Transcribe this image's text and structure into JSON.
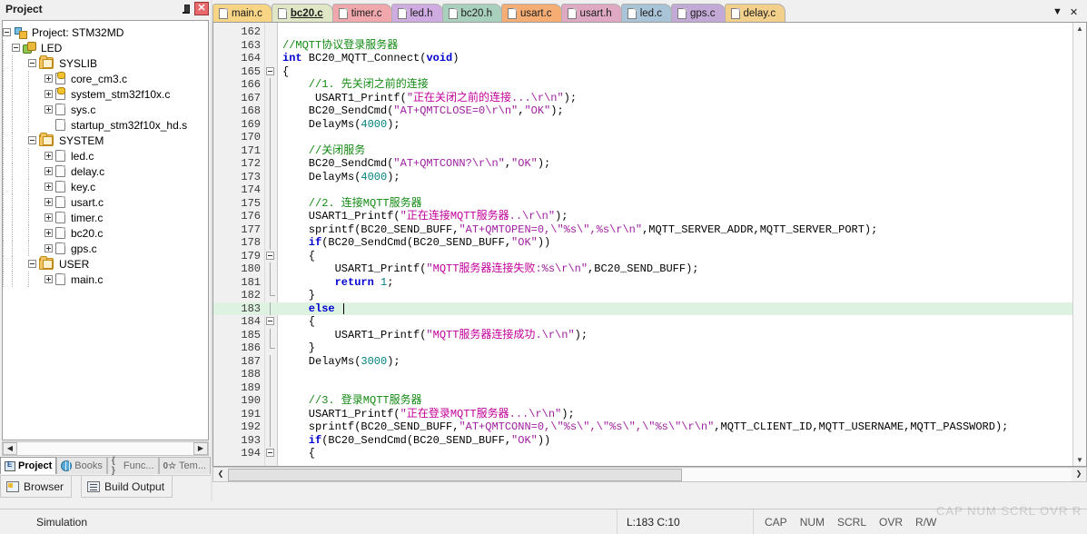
{
  "project_panel": {
    "title": "Project",
    "pin_icon": "pin-icon",
    "close_icon": "close-icon",
    "tree": [
      {
        "label": "Project: STM32MD",
        "depth": 0,
        "expander": "minus",
        "icon": "project-icon"
      },
      {
        "label": "LED",
        "depth": 1,
        "expander": "minus",
        "icon": "target-icon"
      },
      {
        "label": "SYSLIB",
        "depth": 2,
        "expander": "minus",
        "icon": "folder-group-icon"
      },
      {
        "label": "core_cm3.c",
        "depth": 3,
        "expander": "plus",
        "icon": "source-file-keyed-icon"
      },
      {
        "label": "system_stm32f10x.c",
        "depth": 3,
        "expander": "plus",
        "icon": "source-file-keyed-icon"
      },
      {
        "label": "sys.c",
        "depth": 3,
        "expander": "plus",
        "icon": "source-file-icon"
      },
      {
        "label": "startup_stm32f10x_hd.s",
        "depth": 3,
        "expander": "none",
        "icon": "source-file-icon"
      },
      {
        "label": "SYSTEM",
        "depth": 2,
        "expander": "minus",
        "icon": "folder-group-icon"
      },
      {
        "label": "led.c",
        "depth": 3,
        "expander": "plus",
        "icon": "source-file-icon"
      },
      {
        "label": "delay.c",
        "depth": 3,
        "expander": "plus",
        "icon": "source-file-icon"
      },
      {
        "label": "key.c",
        "depth": 3,
        "expander": "plus",
        "icon": "source-file-icon"
      },
      {
        "label": "usart.c",
        "depth": 3,
        "expander": "plus",
        "icon": "source-file-icon"
      },
      {
        "label": "timer.c",
        "depth": 3,
        "expander": "plus",
        "icon": "source-file-icon"
      },
      {
        "label": "bc20.c",
        "depth": 3,
        "expander": "plus",
        "icon": "source-file-icon"
      },
      {
        "label": "gps.c",
        "depth": 3,
        "expander": "plus",
        "icon": "source-file-icon"
      },
      {
        "label": "USER",
        "depth": 2,
        "expander": "minus",
        "icon": "folder-group-icon"
      },
      {
        "label": "main.c",
        "depth": 3,
        "expander": "plus",
        "icon": "source-file-icon"
      }
    ],
    "panel_tabs": [
      {
        "label": "Project",
        "active": true,
        "icon": "project-tab-icon"
      },
      {
        "label": "Books",
        "active": false,
        "icon": "books-globe-icon"
      },
      {
        "label": "Func...",
        "active": false,
        "icon": "braces-icon"
      },
      {
        "label": "Tem...",
        "active": false,
        "icon": "templates-icon"
      }
    ],
    "dock_tabs": [
      {
        "label": "Browser",
        "icon": "browser-icon"
      },
      {
        "label": "Build Output",
        "icon": "build-output-icon"
      }
    ]
  },
  "editor": {
    "tabs": [
      {
        "label": "main.c",
        "active": false,
        "color": "#f8d485"
      },
      {
        "label": "bc20.c",
        "active": true,
        "color": "#dfe7c6"
      },
      {
        "label": "timer.c",
        "active": false,
        "color": "#f0a8ac"
      },
      {
        "label": "led.h",
        "active": false,
        "color": "#ceabe0"
      },
      {
        "label": "bc20.h",
        "active": false,
        "color": "#a9cfbd"
      },
      {
        "label": "usart.c",
        "active": false,
        "color": "#f5ad74"
      },
      {
        "label": "usart.h",
        "active": false,
        "color": "#dfa9c4"
      },
      {
        "label": "led.c",
        "active": false,
        "color": "#a8c4d6"
      },
      {
        "label": "gps.c",
        "active": false,
        "color": "#c3a9d6"
      },
      {
        "label": "delay.c",
        "active": false,
        "color": "#f2cf8a"
      }
    ],
    "tab_dropdown_icon": "chevron-down-icon",
    "tab_close_icon": "close-icon",
    "current_line": 183,
    "lines": [
      {
        "n": 162,
        "fold": "",
        "tokens": []
      },
      {
        "n": 163,
        "fold": "",
        "tokens": [
          {
            "t": "//MQTT协议登录服务器",
            "c": "c",
            "ind": 0
          }
        ]
      },
      {
        "n": 164,
        "fold": "",
        "tokens": [
          {
            "t": "int",
            "c": "k",
            "ind": 0
          },
          {
            "t": " BC20_MQTT_Connect(",
            "c": "p"
          },
          {
            "t": "void",
            "c": "k"
          },
          {
            "t": ")",
            "c": "p"
          }
        ]
      },
      {
        "n": 165,
        "fold": "start",
        "tokens": [
          {
            "t": "{",
            "c": "p",
            "ind": 0
          }
        ]
      },
      {
        "n": 166,
        "fold": "bar",
        "tokens": [
          {
            "t": "//1. 先关闭之前的连接",
            "c": "c",
            "ind": 4
          }
        ]
      },
      {
        "n": 167,
        "fold": "bar",
        "tokens": [
          {
            "t": " USART1_Printf(",
            "c": "p",
            "ind": 4
          },
          {
            "t": "\"",
            "c": "s"
          },
          {
            "t": "正在关闭之前的连接",
            "c": "cz"
          },
          {
            "t": "...\\r\\n\"",
            "c": "s"
          },
          {
            "t": ");",
            "c": "p"
          }
        ]
      },
      {
        "n": 168,
        "fold": "bar",
        "tokens": [
          {
            "t": "BC20_SendCmd(",
            "c": "p",
            "ind": 4
          },
          {
            "t": "\"AT+QMTCLOSE=0\\r\\n\"",
            "c": "s"
          },
          {
            "t": ",",
            "c": "p"
          },
          {
            "t": "\"OK\"",
            "c": "s"
          },
          {
            "t": ");",
            "c": "p"
          }
        ]
      },
      {
        "n": 169,
        "fold": "bar",
        "tokens": [
          {
            "t": "DelayMs(",
            "c": "p",
            "ind": 4
          },
          {
            "t": "4000",
            "c": "n"
          },
          {
            "t": ");",
            "c": "p"
          }
        ]
      },
      {
        "n": 170,
        "fold": "bar",
        "tokens": []
      },
      {
        "n": 171,
        "fold": "bar",
        "tokens": [
          {
            "t": "//关闭服务",
            "c": "c",
            "ind": 4
          }
        ]
      },
      {
        "n": 172,
        "fold": "bar",
        "tokens": [
          {
            "t": "BC20_SendCmd(",
            "c": "p",
            "ind": 4
          },
          {
            "t": "\"AT+QMTCONN?\\r\\n\"",
            "c": "s"
          },
          {
            "t": ",",
            "c": "p"
          },
          {
            "t": "\"OK\"",
            "c": "s"
          },
          {
            "t": ");",
            "c": "p"
          }
        ]
      },
      {
        "n": 173,
        "fold": "bar",
        "tokens": [
          {
            "t": "DelayMs(",
            "c": "p",
            "ind": 4
          },
          {
            "t": "4000",
            "c": "n"
          },
          {
            "t": ");",
            "c": "p"
          }
        ]
      },
      {
        "n": 174,
        "fold": "bar",
        "tokens": []
      },
      {
        "n": 175,
        "fold": "bar",
        "tokens": [
          {
            "t": "//2. 连接MQTT服务器",
            "c": "c",
            "ind": 4
          }
        ]
      },
      {
        "n": 176,
        "fold": "bar",
        "tokens": [
          {
            "t": "USART1_Printf(",
            "c": "p",
            "ind": 4
          },
          {
            "t": "\"",
            "c": "s"
          },
          {
            "t": "正在连接MQTT服务器",
            "c": "cz"
          },
          {
            "t": "..\\r\\n\"",
            "c": "s"
          },
          {
            "t": ");",
            "c": "p"
          }
        ]
      },
      {
        "n": 177,
        "fold": "bar",
        "tokens": [
          {
            "t": "sprintf(BC20_SEND_BUFF,",
            "c": "p",
            "ind": 4
          },
          {
            "t": "\"AT+QMTOPEN=0,\\\"%s\\\",%s\\r\\n\"",
            "c": "s"
          },
          {
            "t": ",MQTT_SERVER_ADDR,MQTT_SERVER_PORT);",
            "c": "p"
          }
        ]
      },
      {
        "n": 178,
        "fold": "bar",
        "tokens": [
          {
            "t": "if",
            "c": "k",
            "ind": 4
          },
          {
            "t": "(BC20_SendCmd(BC20_SEND_BUFF,",
            "c": "p"
          },
          {
            "t": "\"OK\"",
            "c": "s"
          },
          {
            "t": "))",
            "c": "p"
          }
        ]
      },
      {
        "n": 179,
        "fold": "start2",
        "tokens": [
          {
            "t": "{",
            "c": "p",
            "ind": 4
          }
        ]
      },
      {
        "n": 180,
        "fold": "bar2",
        "tokens": [
          {
            "t": "USART1_Printf(",
            "c": "p",
            "ind": 8
          },
          {
            "t": "\"",
            "c": "s"
          },
          {
            "t": "MQTT服务器连接失败",
            "c": "cz"
          },
          {
            "t": ":%s\\r\\n\"",
            "c": "s"
          },
          {
            "t": ",BC20_SEND_BUFF);",
            "c": "p"
          }
        ]
      },
      {
        "n": 181,
        "fold": "bar2",
        "tokens": [
          {
            "t": "return",
            "c": "k",
            "ind": 8
          },
          {
            "t": " ",
            "c": "p"
          },
          {
            "t": "1",
            "c": "n"
          },
          {
            "t": ";",
            "c": "p"
          }
        ]
      },
      {
        "n": 182,
        "fold": "end2",
        "tokens": [
          {
            "t": "}",
            "c": "p",
            "ind": 4
          }
        ]
      },
      {
        "n": 183,
        "fold": "bar",
        "tokens": [
          {
            "t": "else",
            "c": "k",
            "ind": 4
          },
          {
            "t": " ",
            "c": "p"
          }
        ]
      },
      {
        "n": 184,
        "fold": "start2",
        "tokens": [
          {
            "t": "{",
            "c": "p",
            "ind": 4
          }
        ]
      },
      {
        "n": 185,
        "fold": "bar2",
        "tokens": [
          {
            "t": "USART1_Printf(",
            "c": "p",
            "ind": 8
          },
          {
            "t": "\"",
            "c": "s"
          },
          {
            "t": "MQTT服务器连接成功",
            "c": "cz"
          },
          {
            "t": ".\\r\\n\"",
            "c": "s"
          },
          {
            "t": ");",
            "c": "p"
          }
        ]
      },
      {
        "n": 186,
        "fold": "end2",
        "tokens": [
          {
            "t": "}",
            "c": "p",
            "ind": 4
          }
        ]
      },
      {
        "n": 187,
        "fold": "bar",
        "tokens": [
          {
            "t": "DelayMs(",
            "c": "p",
            "ind": 4
          },
          {
            "t": "3000",
            "c": "n"
          },
          {
            "t": ");",
            "c": "p"
          }
        ]
      },
      {
        "n": 188,
        "fold": "bar",
        "tokens": []
      },
      {
        "n": 189,
        "fold": "bar",
        "tokens": []
      },
      {
        "n": 190,
        "fold": "bar",
        "tokens": [
          {
            "t": "//3. 登录MQTT服务器",
            "c": "c",
            "ind": 4
          }
        ]
      },
      {
        "n": 191,
        "fold": "bar",
        "tokens": [
          {
            "t": "USART1_Printf(",
            "c": "p",
            "ind": 4
          },
          {
            "t": "\"",
            "c": "s"
          },
          {
            "t": "正在登录MQTT服务器",
            "c": "cz"
          },
          {
            "t": "...\\r\\n\"",
            "c": "s"
          },
          {
            "t": ");",
            "c": "p"
          }
        ]
      },
      {
        "n": 192,
        "fold": "bar",
        "tokens": [
          {
            "t": "sprintf(BC20_SEND_BUFF,",
            "c": "p",
            "ind": 4
          },
          {
            "t": "\"AT+QMTCONN=0,\\\"%s\\\",\\\"%s\\\",\\\"%s\\\"\\r\\n\"",
            "c": "s"
          },
          {
            "t": ",MQTT_CLIENT_ID,MQTT_USERNAME,MQTT_PASSWORD);",
            "c": "p"
          }
        ]
      },
      {
        "n": 193,
        "fold": "bar",
        "tokens": [
          {
            "t": "if",
            "c": "k",
            "ind": 4
          },
          {
            "t": "(BC20_SendCmd(BC20_SEND_BUFF,",
            "c": "p"
          },
          {
            "t": "\"OK\"",
            "c": "s"
          },
          {
            "t": "))",
            "c": "p"
          }
        ]
      },
      {
        "n": 194,
        "fold": "start2",
        "tokens": [
          {
            "t": "{",
            "c": "p",
            "ind": 4
          }
        ]
      }
    ]
  },
  "status_bar": {
    "mode": "Simulation",
    "cursor": "L:183 C:10",
    "indicators": [
      "CAP",
      "NUM",
      "SCRL",
      "OVR",
      "R/W"
    ],
    "watermark": "CAP NUM SCRL OVR R/W"
  }
}
